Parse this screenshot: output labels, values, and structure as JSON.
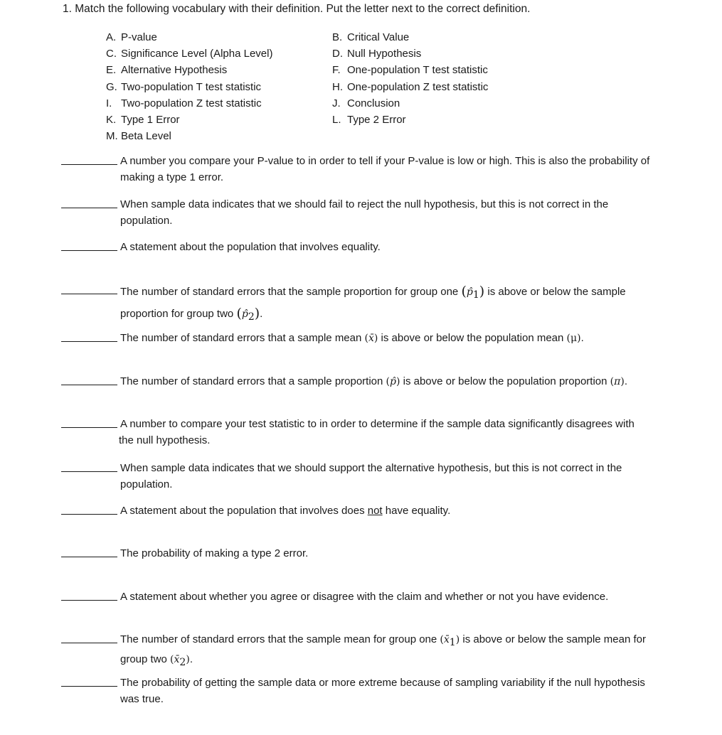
{
  "instruction": "1.  Match the following vocabulary with their definition. Put the letter next to the correct definition.",
  "terms": [
    {
      "letter": "A.",
      "label": "P-value"
    },
    {
      "letter": "B.",
      "label": "Critical Value"
    },
    {
      "letter": "C.",
      "label": "Significance Level (Alpha Level)"
    },
    {
      "letter": "D.",
      "label": "Null Hypothesis"
    },
    {
      "letter": "E.",
      "label": "Alternative Hypothesis"
    },
    {
      "letter": "F.",
      "label": "One-population T test statistic"
    },
    {
      "letter": "G.",
      "label": "Two-population T test statistic"
    },
    {
      "letter": "H.",
      "label": "One-population Z test statistic"
    },
    {
      "letter": "I.",
      "label": "Two-population Z test statistic"
    },
    {
      "letter": "J.",
      "label": "Conclusion"
    },
    {
      "letter": "K.",
      "label": "Type 1 Error"
    },
    {
      "letter": "L.",
      "label": "Type 2 Error"
    },
    {
      "letter": "M.",
      "label": "Beta Level"
    }
  ],
  "questions": [
    {
      "answer": "",
      "text": "A number you compare your P-value to in order to tell if your P-value is low or high. This is also the probability of making a type 1 error."
    },
    {
      "answer": "",
      "text": "When sample data indicates that we should fail to reject the null hypothesis, but this is not correct in the population."
    },
    {
      "answer": "",
      "text": "A statement about the population that involves equality."
    },
    {
      "answer": "",
      "text_a": "The number of standard errors that the sample proportion for group one",
      "sym_a": "p̂",
      "sub_a": "1",
      "text_b": "is above or below the sample proportion for group two",
      "sym_b": "p̂",
      "sub_b": "2",
      "text_c": "."
    },
    {
      "answer": "",
      "text_a": "The number of standard errors that a sample mean",
      "sym_a": "x̄",
      "text_b": "is above or below the population mean",
      "sym_b": "μ",
      "text_c": "."
    },
    {
      "answer": "",
      "text_a": "The number of standard errors that a sample proportion",
      "sym_a": "p̂",
      "text_b": "is above or below the population proportion",
      "sym_b": "π",
      "text_c": "."
    },
    {
      "answer": "",
      "text": "A number to compare your test statistic to in order to determine if the sample data significantly disagrees with the null hypothesis."
    },
    {
      "answer": "",
      "text": "When sample data indicates that we should support the alternative hypothesis, but this is not correct in the population."
    },
    {
      "answer": "",
      "text_a": "A statement about the population that involves does",
      "emph": "not",
      "text_b": "have equality."
    },
    {
      "answer": "",
      "text": "The probability of making a type 2 error."
    },
    {
      "answer": "",
      "text": "A statement about whether you agree or disagree with the claim and whether or not you have evidence."
    },
    {
      "answer": "",
      "text_a": "The number of standard errors that the sample mean for group one",
      "sym_a": "x̄",
      "sub_a": "1",
      "text_b": "is above or below the sample mean for group two",
      "sym_b": "x̄",
      "sub_b": "2",
      "text_c": "."
    },
    {
      "answer": "",
      "text": "The probability of getting the sample data or more extreme because of sampling variability if the null hypothesis was true."
    }
  ]
}
